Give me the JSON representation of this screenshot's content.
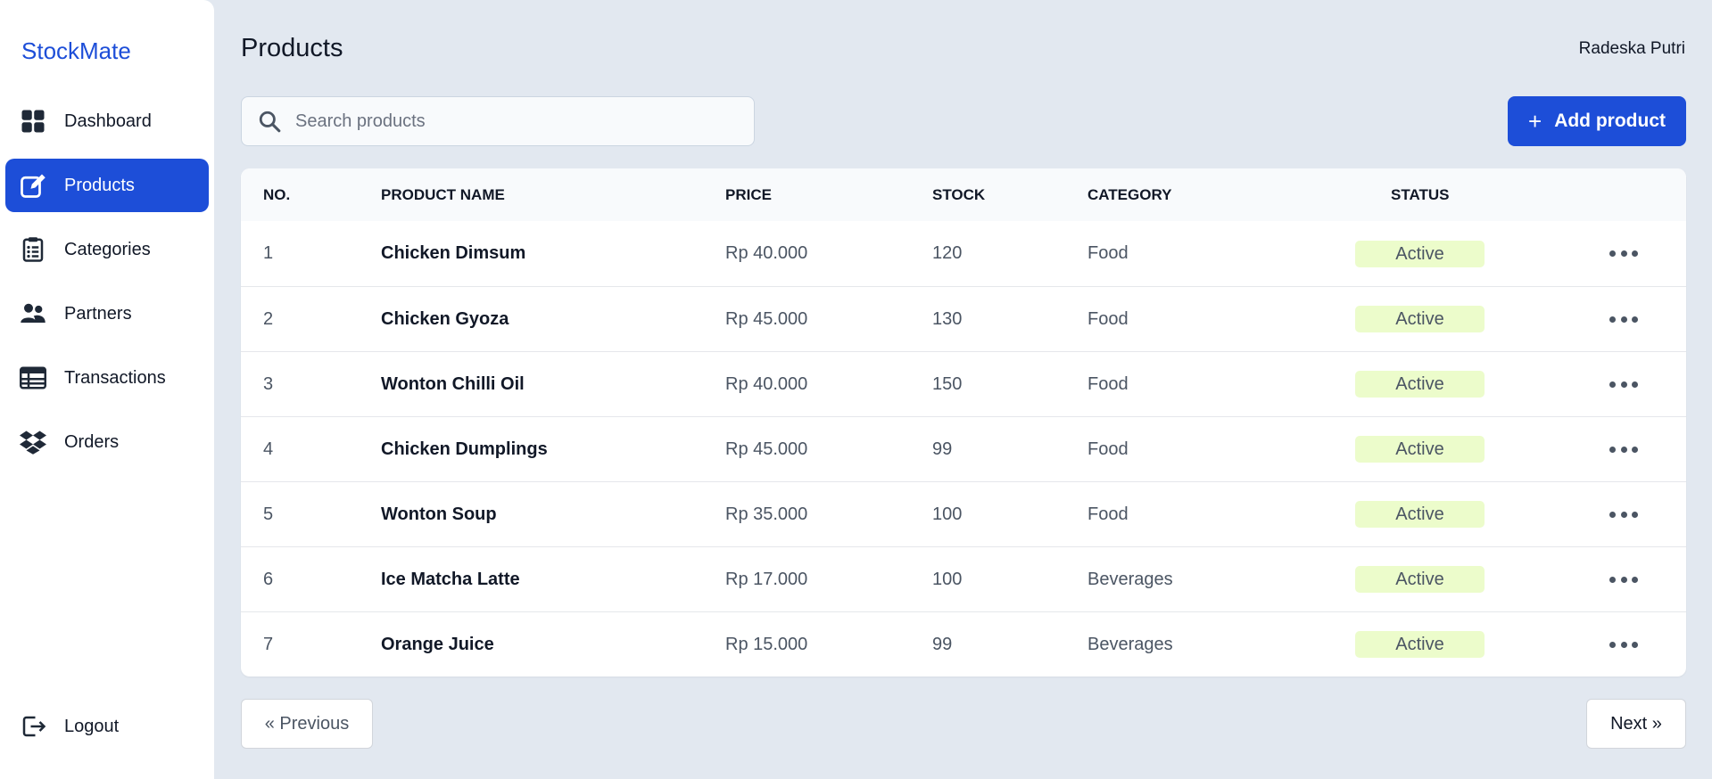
{
  "app": {
    "brand": "StockMate",
    "user": "Radeska Putri"
  },
  "sidebar": {
    "items": [
      {
        "label": "Dashboard",
        "icon": "dashboard-grid-icon",
        "active": false
      },
      {
        "label": "Products",
        "icon": "edit-icon",
        "active": true
      },
      {
        "label": "Categories",
        "icon": "clipboard-list-icon",
        "active": false
      },
      {
        "label": "Partners",
        "icon": "users-icon",
        "active": false
      },
      {
        "label": "Transactions",
        "icon": "table-icon",
        "active": false
      },
      {
        "label": "Orders",
        "icon": "dropbox-icon",
        "active": false
      }
    ],
    "logout": {
      "label": "Logout",
      "icon": "logout-icon"
    }
  },
  "header": {
    "title": "Products"
  },
  "search": {
    "placeholder": "Search products",
    "value": ""
  },
  "toolbar": {
    "add_label": "Add product"
  },
  "table": {
    "columns": [
      "NO.",
      "PRODUCT NAME",
      "PRICE",
      "STOCK",
      "CATEGORY",
      "STATUS"
    ],
    "rows": [
      {
        "no": "1",
        "name": "Chicken Dimsum",
        "price": "Rp 40.000",
        "stock": "120",
        "category": "Food",
        "status": "Active"
      },
      {
        "no": "2",
        "name": "Chicken Gyoza",
        "price": "Rp 45.000",
        "stock": "130",
        "category": "Food",
        "status": "Active"
      },
      {
        "no": "3",
        "name": "Wonton Chilli Oil",
        "price": "Rp 40.000",
        "stock": "150",
        "category": "Food",
        "status": "Active"
      },
      {
        "no": "4",
        "name": "Chicken Dumplings",
        "price": "Rp 45.000",
        "stock": "99",
        "category": "Food",
        "status": "Active"
      },
      {
        "no": "5",
        "name": "Wonton Soup",
        "price": "Rp 35.000",
        "stock": "100",
        "category": "Food",
        "status": "Active"
      },
      {
        "no": "6",
        "name": "Ice Matcha Latte",
        "price": "Rp 17.000",
        "stock": "100",
        "category": "Beverages",
        "status": "Active"
      },
      {
        "no": "7",
        "name": "Orange Juice",
        "price": "Rp 15.000",
        "stock": "99",
        "category": "Beverages",
        "status": "Active"
      }
    ]
  },
  "pagination": {
    "prev_label": "« Previous",
    "next_label": "Next »"
  },
  "colors": {
    "accent": "#1d4ed8",
    "background": "#e2e8f0",
    "status_active_bg": "#ecfccb"
  }
}
